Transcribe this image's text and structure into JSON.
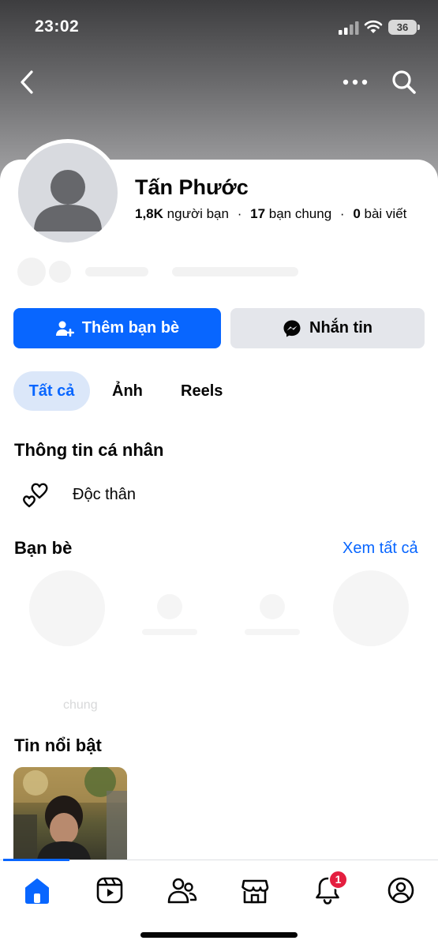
{
  "status_bar": {
    "time": "23:02",
    "battery": "36"
  },
  "profile": {
    "name": "Tấn Phước",
    "friends_count": "1,8K",
    "friends_label": "người bạn",
    "mutual_count": "17",
    "mutual_label": "bạn chung",
    "posts_count": "0",
    "posts_label": "bài viết",
    "separator": "·"
  },
  "actions": {
    "add_friend_label": "Thêm bạn bè",
    "message_label": "Nhắn tin"
  },
  "tabs": [
    {
      "label": "Tất cả",
      "active": true
    },
    {
      "label": "Ảnh",
      "active": false
    },
    {
      "label": "Reels",
      "active": false
    }
  ],
  "about": {
    "title": "Thông tin cá nhân",
    "relationship": "Độc thân"
  },
  "friends": {
    "title": "Bạn bè",
    "see_all": "Xem tất cả",
    "faded_caption": "chung"
  },
  "highlights": {
    "title": "Tin nổi bật"
  },
  "bottom_nav": {
    "items": [
      {
        "icon": "home-icon",
        "active": true
      },
      {
        "icon": "reels-icon",
        "active": false
      },
      {
        "icon": "friends-icon",
        "active": false
      },
      {
        "icon": "marketplace-icon",
        "active": false
      },
      {
        "icon": "bell-icon",
        "active": false
      },
      {
        "icon": "profile-icon",
        "active": false
      }
    ],
    "notification_badge": "1"
  },
  "colors": {
    "accent": "#0866ff",
    "badge": "#e41e3f",
    "secondary_button": "#e4e6eb",
    "active_tab_bg": "#dbe7f9"
  }
}
